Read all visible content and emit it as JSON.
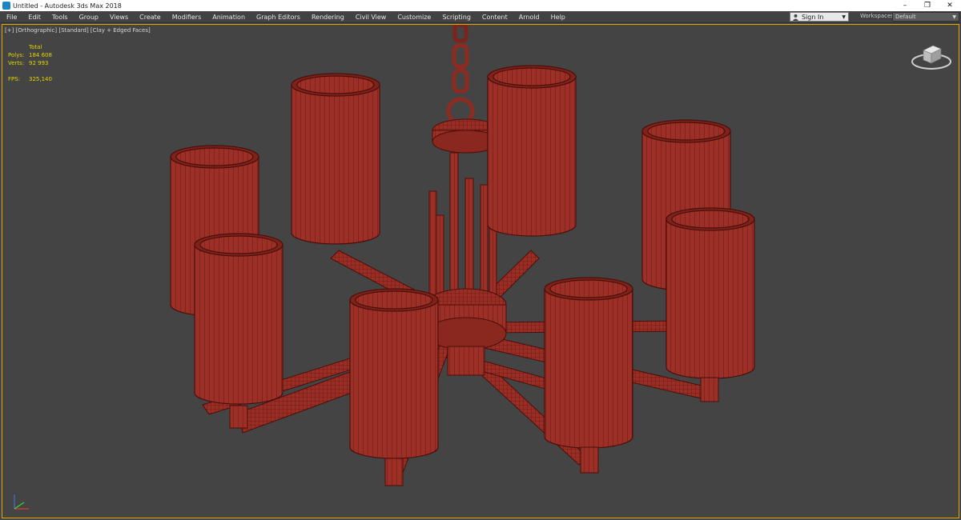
{
  "window": {
    "title": "Untitled - Autodesk 3ds Max 2018",
    "controls": {
      "minimize": "–",
      "restore": "❐",
      "close": "✕"
    }
  },
  "menu": {
    "items": [
      "File",
      "Edit",
      "Tools",
      "Group",
      "Views",
      "Create",
      "Modifiers",
      "Animation",
      "Graph Editors",
      "Rendering",
      "Civil View",
      "Customize",
      "Scripting",
      "Content",
      "Arnold",
      "Help"
    ],
    "signin_label": "Sign In",
    "workspaces_label": "Workspaces:",
    "workspaces_value": "Default"
  },
  "viewport": {
    "label": "[+] [Orthographic] [Standard] [Clay + Edged Faces]",
    "stats": {
      "total_label": "Total",
      "polys_label": "Polys:",
      "polys_value": "184 608",
      "verts_label": "Verts:",
      "verts_value": "92 993",
      "fps_label": "FPS:",
      "fps_value": "325,140"
    }
  },
  "colors": {
    "viewport_bg": "#444444",
    "model_fill": "#9c2f26",
    "wire": "#4a0f0b",
    "stats_text": "#e4d400",
    "active_border": "#e0a800"
  },
  "icons": [
    "app-icon",
    "user-icon",
    "viewcube-icon",
    "axis-tripod-icon"
  ]
}
